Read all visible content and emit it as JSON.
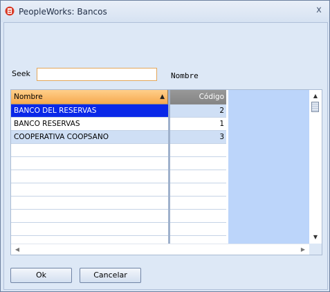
{
  "window": {
    "title": "PeopleWorks: Bancos",
    "close_glyph": "x"
  },
  "search": {
    "label": "Seek",
    "value": "",
    "order_label": "Nombre"
  },
  "grid": {
    "columns": [
      {
        "label": "Nombre",
        "sorted": "ascending"
      },
      {
        "label": "Código"
      }
    ],
    "rows": [
      {
        "nombre": "BANCO DEL RESERVAS",
        "codigo": "2",
        "selected": true
      },
      {
        "nombre": "BANCO RESERVAS",
        "codigo": "1"
      },
      {
        "nombre": "COOPERATIVA COOPSANO",
        "codigo": "3"
      }
    ]
  },
  "buttons": {
    "ok_label": "Ok",
    "cancel_label": "Cancelar"
  },
  "colors": {
    "header_name": "#f6a94e",
    "header_code": "#858585",
    "selection": "#0a28e8",
    "grid_fill": "#bcd5fa"
  }
}
